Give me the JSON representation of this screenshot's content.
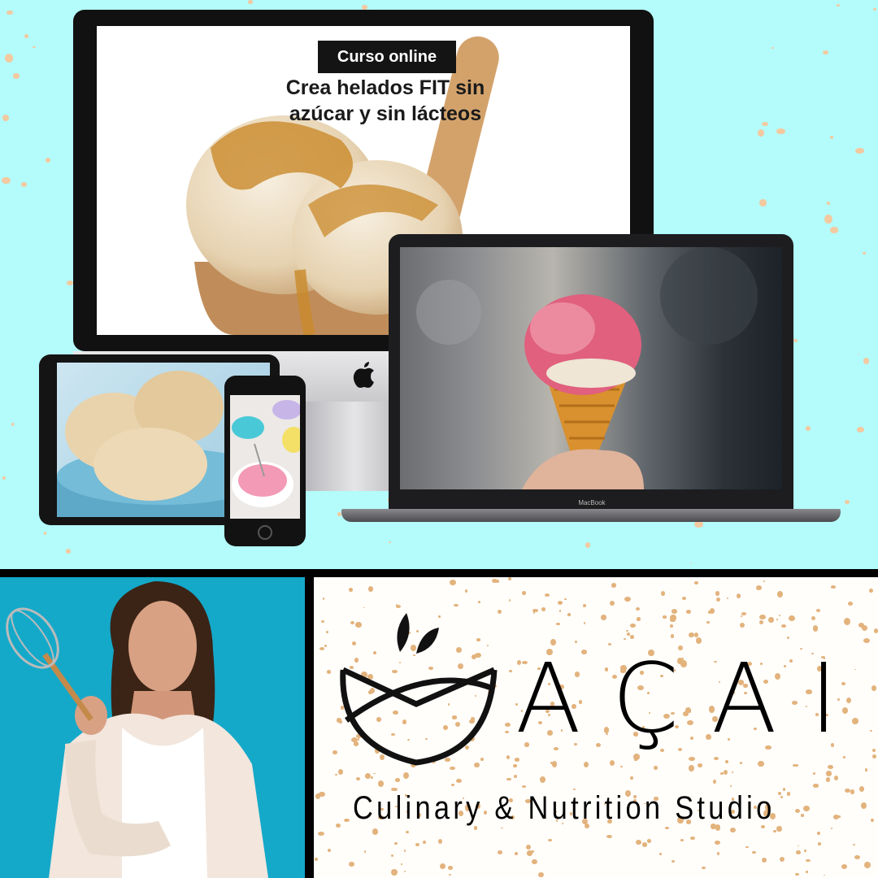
{
  "course": {
    "badge": "Curso online",
    "headline_line1": "Crea helados FIT sin",
    "headline_line2": "azúcar y sin lácteos"
  },
  "devices": {
    "laptop_label": "MacBook"
  },
  "brand": {
    "name": "AÇAI",
    "tagline": "Culinary & Nutrition Studio"
  },
  "colors": {
    "background_top": "#b4fbfb",
    "speckle": "#f3c9a0",
    "photo_background": "#14a9c9",
    "divider": "#000000"
  }
}
